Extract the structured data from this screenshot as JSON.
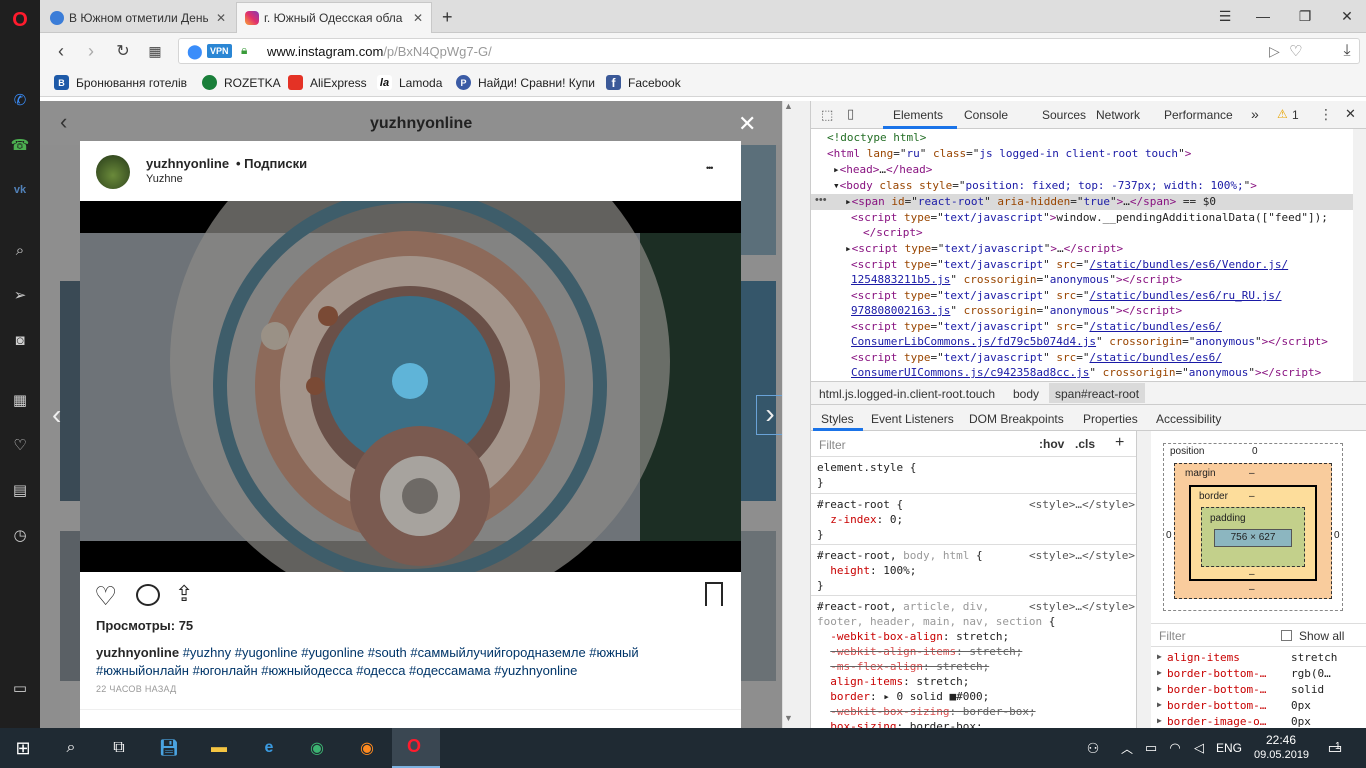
{
  "browser": {
    "tabs": [
      {
        "title": "В Южном отметили День",
        "active": false
      },
      {
        "title": "г. Южный Одесская обла",
        "active": true
      }
    ],
    "url_host": "www.instagram.com",
    "url_path": "/p/BxN4QpWg7-G/",
    "vpn_label": "VPN",
    "bookmarks": [
      {
        "label": "Бронювання готелів",
        "icon": "B",
        "color": "#1e5aa8"
      },
      {
        "label": "ROZETKA",
        "icon": "",
        "color": "#1a7f3a"
      },
      {
        "label": "AliExpress",
        "icon": "",
        "color": "#e43225"
      },
      {
        "label": "Lamoda",
        "icon": "la",
        "color": "#111111"
      },
      {
        "label": "Найди! Сравни! Купи",
        "icon": "P",
        "color": "#3b5ba5"
      },
      {
        "label": "Facebook",
        "icon": "f",
        "color": "#3b5998"
      }
    ]
  },
  "instagram": {
    "header_username": "yuzhnyonline",
    "close_glyph": "✕",
    "post_user": "yuzhnyonline",
    "post_follow": "• Подписки",
    "post_location": "Yuzhne",
    "more_glyph": "•••",
    "views": "Просмотры: 75",
    "caption_user": "yuzhnyonline",
    "caption_tags_line1": "#yuzhny #yugonline #yugonline #south #саммыйлучийгородназемле #южный",
    "caption_tags_line2": "#южныйонлайн #югонлайн #южныйодесса #одесса #одессамама #yuzhnyonline",
    "timestamp": "22 ЧАСОВ НАЗАД"
  },
  "devtools": {
    "tabs": [
      "Elements",
      "Console",
      "Sources",
      "Network",
      "Performance"
    ],
    "warning_count": "1",
    "dom": [
      {
        "html": "<span class='cm'>&lt;!doctype html&gt;</span>"
      },
      {
        "html": "<span class='tag'>&lt;html </span><span class='attr'>lang</span>=\"<span class='val'>ru</span>\" <span class='attr'>class</span>=\"<span class='val'>js logged-in client-root touch</span>\"<span class='tag'>&gt;</span>"
      },
      {
        "html": "▸<span class='tag'>&lt;head&gt;</span>…<span class='tag'>&lt;/head&gt;</span>"
      },
      {
        "html": "▾<span class='tag'>&lt;body </span><span class='attr'>class style</span>=\"<span class='val'>position: fixed; top: -737px; width: 100%;</span>\"<span class='tag'>&gt;</span>"
      },
      {
        "html": "▸<span class='tag'>&lt;span </span><span class='attr'>id</span>=\"<span class='val'>react-root</span>\" <span class='attr'>aria-hidden</span>=\"<span class='val'>true</span>\"<span class='tag'>&gt;</span>…<span class='tag'>&lt;/span&gt;</span> == $0"
      },
      {
        "html": "<span class='tag'>&lt;script </span><span class='attr'>type</span>=\"<span class='val'>text/javascript</span>\"<span class='tag'>&gt;</span><span class='txt'>window.__pendingAdditionalData([\"feed\"]);</span>"
      },
      {
        "html": "<span class='tag'>&lt;/script&gt;</span>"
      },
      {
        "html": "▸<span class='tag'>&lt;script </span><span class='attr'>type</span>=\"<span class='val'>text/javascript</span>\"<span class='tag'>&gt;</span>…<span class='tag'>&lt;/script&gt;</span>"
      },
      {
        "html": "<span class='tag'>&lt;script </span><span class='attr'>type</span>=\"<span class='val'>text/javascript</span>\" <span class='attr'>src</span>=\"<span class='link'>/static/bundles/es6/Vendor.js/</span>"
      },
      {
        "html": "<span class='link'>1254883211b5.js</span>\" <span class='attr'>crossorigin</span>=\"<span class='val'>anonymous</span>\"<span class='tag'>&gt;&lt;/script&gt;</span>"
      },
      {
        "html": "<span class='tag'>&lt;script </span><span class='attr'>type</span>=\"<span class='val'>text/javascript</span>\" <span class='attr'>src</span>=\"<span class='link'>/static/bundles/es6/ru_RU.js/</span>"
      },
      {
        "html": "<span class='link'>978808002163.js</span>\" <span class='attr'>crossorigin</span>=\"<span class='val'>anonymous</span>\"<span class='tag'>&gt;&lt;/script&gt;</span>"
      },
      {
        "html": "<span class='tag'>&lt;script </span><span class='attr'>type</span>=\"<span class='val'>text/javascript</span>\" <span class='attr'>src</span>=\"<span class='link'>/static/bundles/es6/</span>"
      },
      {
        "html": "<span class='link'>ConsumerLibCommons.js/fd79c5b074d4.js</span>\" <span class='attr'>crossorigin</span>=\"<span class='val'>anonymous</span>\"<span class='tag'>&gt;&lt;/script&gt;</span>"
      },
      {
        "html": "<span class='tag'>&lt;script </span><span class='attr'>type</span>=\"<span class='val'>text/javascript</span>\" <span class='attr'>src</span>=\"<span class='link'>/static/bundles/es6/</span>"
      },
      {
        "html": "<span class='link'>ConsumerUICommons.js/c942358ad8cc.js</span>\" <span class='attr'>crossorigin</span>=\"<span class='val'>anonymous</span>\"<span class='tag'>&gt;&lt;/script&gt;</span>"
      }
    ],
    "breadcrumbs": [
      "html.js.logged-in.client-root.touch",
      "body",
      "span#react-root"
    ],
    "style_tabs": [
      "Styles",
      "Event Listeners",
      "DOM Breakpoints",
      "Properties",
      "Accessibility"
    ],
    "filter_placeholder": "Filter",
    "hov": ":hov",
    "cls": ".cls",
    "box_model": {
      "position": "position",
      "margin": "margin",
      "border": "border",
      "padding": "padding",
      "content": "756 × 627",
      "zero": "0",
      "dash": "–"
    },
    "computed_filter": "Filter",
    "show_all": "Show all",
    "computed": [
      {
        "name": "align-items",
        "value": "stretch"
      },
      {
        "name": "border-bottom-…",
        "value": "rgb(0…"
      },
      {
        "name": "border-bottom-…",
        "value": "solid"
      },
      {
        "name": "border-bottom-…",
        "value": "0px"
      },
      {
        "name": "border-image-o…",
        "value": "0px"
      }
    ]
  },
  "taskbar": {
    "lang": "ENG",
    "time": "22:46",
    "date": "09.05.2019",
    "notif_count": "1"
  }
}
